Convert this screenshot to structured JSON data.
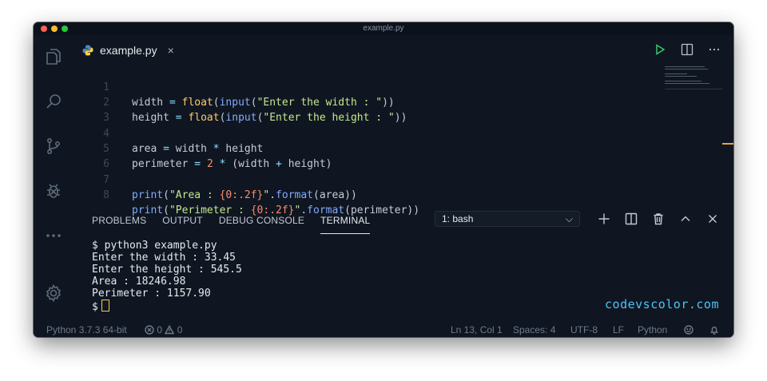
{
  "window": {
    "title": "example.py"
  },
  "activity_bar": [
    "explorer-icon",
    "search-icon",
    "source-control-icon",
    "debug-icon",
    "more-icon",
    "settings-gear-icon"
  ],
  "tab": {
    "label": "example.py",
    "close": "×"
  },
  "code": {
    "line_numbers": [
      "1",
      "2",
      "3",
      "4",
      "5",
      "6",
      "7",
      "8"
    ],
    "tokens": {
      "l1_var": "width",
      "l1_eq": " = ",
      "l1_fn": "float",
      "l1_p1": "(",
      "l1_in": "input",
      "l1_p2": "(",
      "l1_str": "\"Enter the width : \"",
      "l1_p3": "))",
      "l2_var": "height",
      "l2_eq": " = ",
      "l2_fn": "float",
      "l2_p1": "(",
      "l2_in": "input",
      "l2_p2": "(",
      "l2_str": "\"Enter the height : \"",
      "l2_p3": "))",
      "l4_a": "area",
      "l4_eq": " = ",
      "l4_w": "width",
      "l4_op": " * ",
      "l4_h": "height",
      "l5_p": "perimeter",
      "l5_eq": " = ",
      "l5_n": "2",
      "l5_op": " * ",
      "l5_rest": "(width ",
      "l5_plus": "+",
      "l5_end": " height)",
      "l7_pr": "print",
      "l7_p1": "(",
      "l7_s1": "\"Area : ",
      "l7_fmt": "{0:.2f}",
      "l7_s2": "\"",
      "l7_dot": ".",
      "l7_fm": "format",
      "l7_end": "(area))",
      "l8_pr": "print",
      "l8_p1": "(",
      "l8_s1": "\"Perimeter : ",
      "l8_fmt": "{0:.2f}",
      "l8_s2": "\"",
      "l8_dot": ".",
      "l8_fm": "format",
      "l8_end": "(perimeter))"
    }
  },
  "panel": {
    "tabs": [
      "PROBLEMS",
      "OUTPUT",
      "DEBUG CONSOLE",
      "TERMINAL"
    ],
    "active_tab": "TERMINAL",
    "shell_select": "1: bash",
    "terminal_lines": [
      "$ python3 example.py",
      "Enter the width : 33.45",
      "Enter the height : 545.5",
      "Area : 18246.98",
      "Perimeter : 1157.90"
    ],
    "prompt": "$"
  },
  "watermark": "codevscolor.com",
  "status": {
    "interpreter": "Python 3.7.3 64-bit",
    "errors": "0",
    "warnings": "0",
    "position": "Ln 13, Col 1",
    "spaces": "Spaces: 4",
    "encoding": "UTF-8",
    "eol": "LF",
    "language": "Python"
  }
}
